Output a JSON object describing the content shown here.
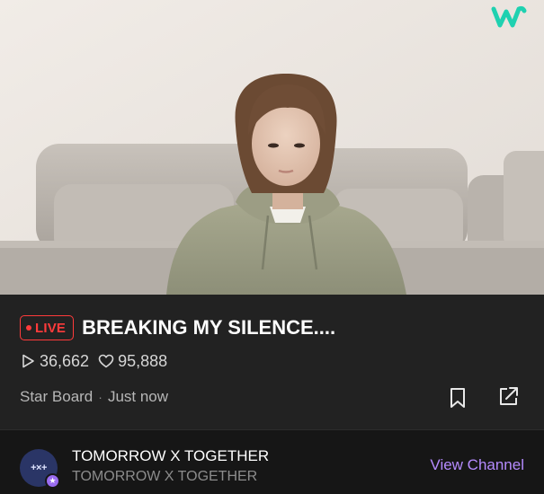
{
  "app": {
    "brand_logo": "weverse-w-logo",
    "accent_color": "#1fd1b0"
  },
  "video": {
    "thumbnail": "person-in-hoodie-on-sofa",
    "live_label": "LIVE",
    "live_color": "#ff3b3b",
    "title": "BREAKING MY SILENCE...."
  },
  "stats": {
    "views_icon": "play-icon",
    "views": "36,662",
    "likes_icon": "heart-icon",
    "likes": "95,888"
  },
  "meta": {
    "board": "Star Board",
    "separator": "·",
    "time": "Just now"
  },
  "actions": {
    "bookmark_icon": "bookmark-icon",
    "share_icon": "share-icon"
  },
  "channel": {
    "avatar_text": "+×+",
    "name": "TOMORROW X TOGETHER",
    "subtitle": "TOMORROW X TOGETHER",
    "view_label": "View Channel",
    "view_color": "#b58bff"
  }
}
